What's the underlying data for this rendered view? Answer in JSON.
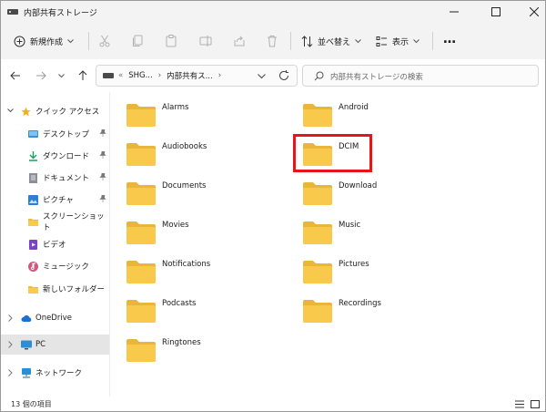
{
  "window": {
    "title": "内部共有ストレージ"
  },
  "toolbar": {
    "new_label": "新規作成",
    "sort_label": "並べ替え",
    "view_label": "表示",
    "more_label": "…"
  },
  "address": {
    "overflow": "«",
    "crumbs": [
      "SHG...",
      "内部共有ス..."
    ],
    "search_placeholder": "内部共有ストレージの検索"
  },
  "sidebar": {
    "quick_access": "クイック アクセス",
    "items": [
      {
        "label": "デスクトップ",
        "icon": "desktop-icon",
        "pinned": true
      },
      {
        "label": "ダウンロード",
        "icon": "download-icon",
        "pinned": true
      },
      {
        "label": "ドキュメント",
        "icon": "document-icon",
        "pinned": true
      },
      {
        "label": "ピクチャ",
        "icon": "pictures-icon",
        "pinned": true
      },
      {
        "label": "スクリーンショット",
        "icon": "folder-icon",
        "pinned": false
      },
      {
        "label": "ビデオ",
        "icon": "video-icon",
        "pinned": false
      },
      {
        "label": "ミュージック",
        "icon": "music-icon",
        "pinned": false
      },
      {
        "label": "新しいフォルダー",
        "icon": "folder-icon",
        "pinned": false
      }
    ],
    "onedrive": "OneDrive",
    "pc": "PC",
    "network": "ネットワーク"
  },
  "folders": [
    "Alarms",
    "Android",
    "Audiobooks",
    "DCIM",
    "Documents",
    "Download",
    "Movies",
    "Music",
    "Notifications",
    "Pictures",
    "Podcasts",
    "Recordings",
    "Ringtones"
  ],
  "highlighted_folder": "DCIM",
  "status": {
    "count_text": "13 個の項目"
  },
  "colors": {
    "folder": "#f8c94b",
    "folder_dark": "#e9b53a",
    "highlight": "#e8141c",
    "accent": "#0067c0"
  }
}
